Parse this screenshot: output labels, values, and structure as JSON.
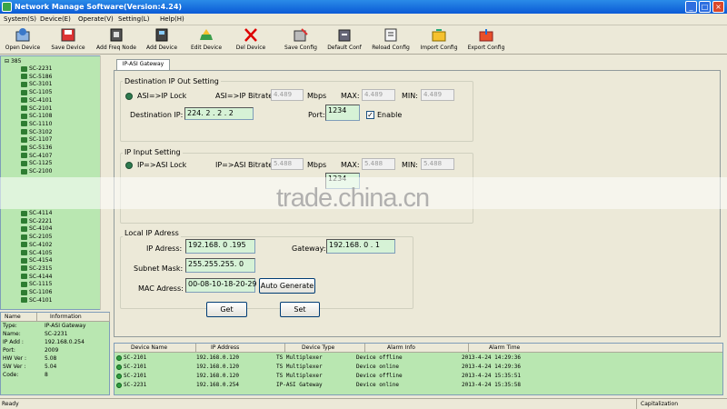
{
  "window": {
    "title": "Network Manage Software(Version:4.24)",
    "min": "_",
    "max": "□",
    "close": "×"
  },
  "menu": [
    "System(S)",
    "Device(E)",
    "Operate(V)",
    "Setting(L)",
    "Help(H)"
  ],
  "toolbar": [
    {
      "label": "Open Device",
      "icon": "open-device-icon"
    },
    {
      "label": "Save Device",
      "icon": "save-device-icon"
    },
    {
      "label": "Add Freq Node",
      "icon": "add-freq-node-icon"
    },
    {
      "label": "Add Device",
      "icon": "add-device-icon"
    },
    {
      "label": "Edit Device",
      "icon": "edit-device-icon"
    },
    {
      "label": "Del Device",
      "icon": "delete-icon"
    },
    {
      "label": "Save Config",
      "icon": "save-config-icon"
    },
    {
      "label": "Default Conf",
      "icon": "default-config-icon"
    },
    {
      "label": "Reload Config",
      "icon": "reload-config-icon"
    },
    {
      "label": "Import Config",
      "icon": "import-config-icon"
    },
    {
      "label": "Export Config",
      "icon": "export-config-icon"
    }
  ],
  "tree": {
    "root": "385",
    "items_top": [
      "SC-2231",
      "SC-5186",
      "SC-3101",
      "SC-1105",
      "SC-4101",
      "SC-2101",
      "SC-1108",
      "SC-1110",
      "SC-3102",
      "SC-1107",
      "SC-5136",
      "SC-4107",
      "SC-1125",
      "SC-2100"
    ],
    "items_bottom": [
      "SC-4114",
      "SC-2221",
      "SC-4104",
      "SC-2105",
      "SC-4102",
      "SC-4105",
      "SC-4154",
      "SC-2315",
      "SC-4144",
      "SC-1115",
      "SC-1106",
      "SC-4101"
    ]
  },
  "info": {
    "headers": [
      "Name",
      "Information"
    ],
    "rows": [
      {
        "k": "Type:",
        "v": "IP-ASI Gateway"
      },
      {
        "k": "Name:",
        "v": "SC-2231"
      },
      {
        "k": "IP Add :",
        "v": "192.168.0.254"
      },
      {
        "k": "Port:",
        "v": "2009"
      },
      {
        "k": "HW Ver :",
        "v": "5.08"
      },
      {
        "k": "SW Ver :",
        "v": "5.04"
      },
      {
        "k": "Code:",
        "v": "8"
      }
    ]
  },
  "tab": "IP-ASI Gateway",
  "dest": {
    "title": "Destination IP Out Setting",
    "lock": "ASI=>IP Lock",
    "bitrate_label": "ASI=>IP Bitrate:",
    "bitrate": "4.489",
    "mbps": "Mbps",
    "max_label": "MAX:",
    "max": "4.489",
    "min_label": "MIN:",
    "min": "4.489",
    "ip_label": "Destination IP:",
    "ip": "224. 2 . 2 . 2",
    "port_label": "Port:",
    "port": "1234",
    "enable": "Enable",
    "enable_mark": "✓"
  },
  "input": {
    "title": "IP Input Setting",
    "lock": "IP=>ASI Lock",
    "bitrate_label": "IP=>ASI Bitrate:",
    "bitrate": "5.488",
    "mbps": "Mbps",
    "max_label": "MAX:",
    "max": "5.488",
    "min_label": "MIN:",
    "min": "5.488",
    "port": "1234"
  },
  "local": {
    "title": "Local IP Adress",
    "ip_label": "IP Adress:",
    "ip": "192.168. 0 .195",
    "gw_label": "Gateway:",
    "gw": "192.168. 0 . 1",
    "mask_label": "Subnet Mask:",
    "mask": "255.255.255. 0",
    "mac_label": "MAC Adress:",
    "mac": "00-08-10-18-20-29",
    "auto": "Auto Generate"
  },
  "buttons": {
    "get": "Get",
    "set": "Set"
  },
  "alarms": {
    "headers": [
      "Device Name",
      "IP Address",
      "Device Type",
      "Alarm Info",
      "Alarm Time"
    ],
    "rows": [
      [
        "SC-2101",
        "192.168.0.120",
        "TS Multiplexer",
        "Device offline",
        "2013-4-24 14:29:36"
      ],
      [
        "SC-2101",
        "192.168.0.120",
        "TS Multiplexer",
        "Device online",
        "2013-4-24 14:29:36"
      ],
      [
        "SC-2101",
        "192.168.0.120",
        "TS Multiplexer",
        "Device offline",
        "2013-4-24 15:35:51"
      ],
      [
        "SC-2231",
        "192.168.0.254",
        "IP-ASI Gateway",
        "Device online",
        "2013-4-24 15:35:58"
      ]
    ]
  },
  "status": {
    "left": "Ready",
    "right": "Capitalization"
  },
  "watermark": "trade.china.cn"
}
